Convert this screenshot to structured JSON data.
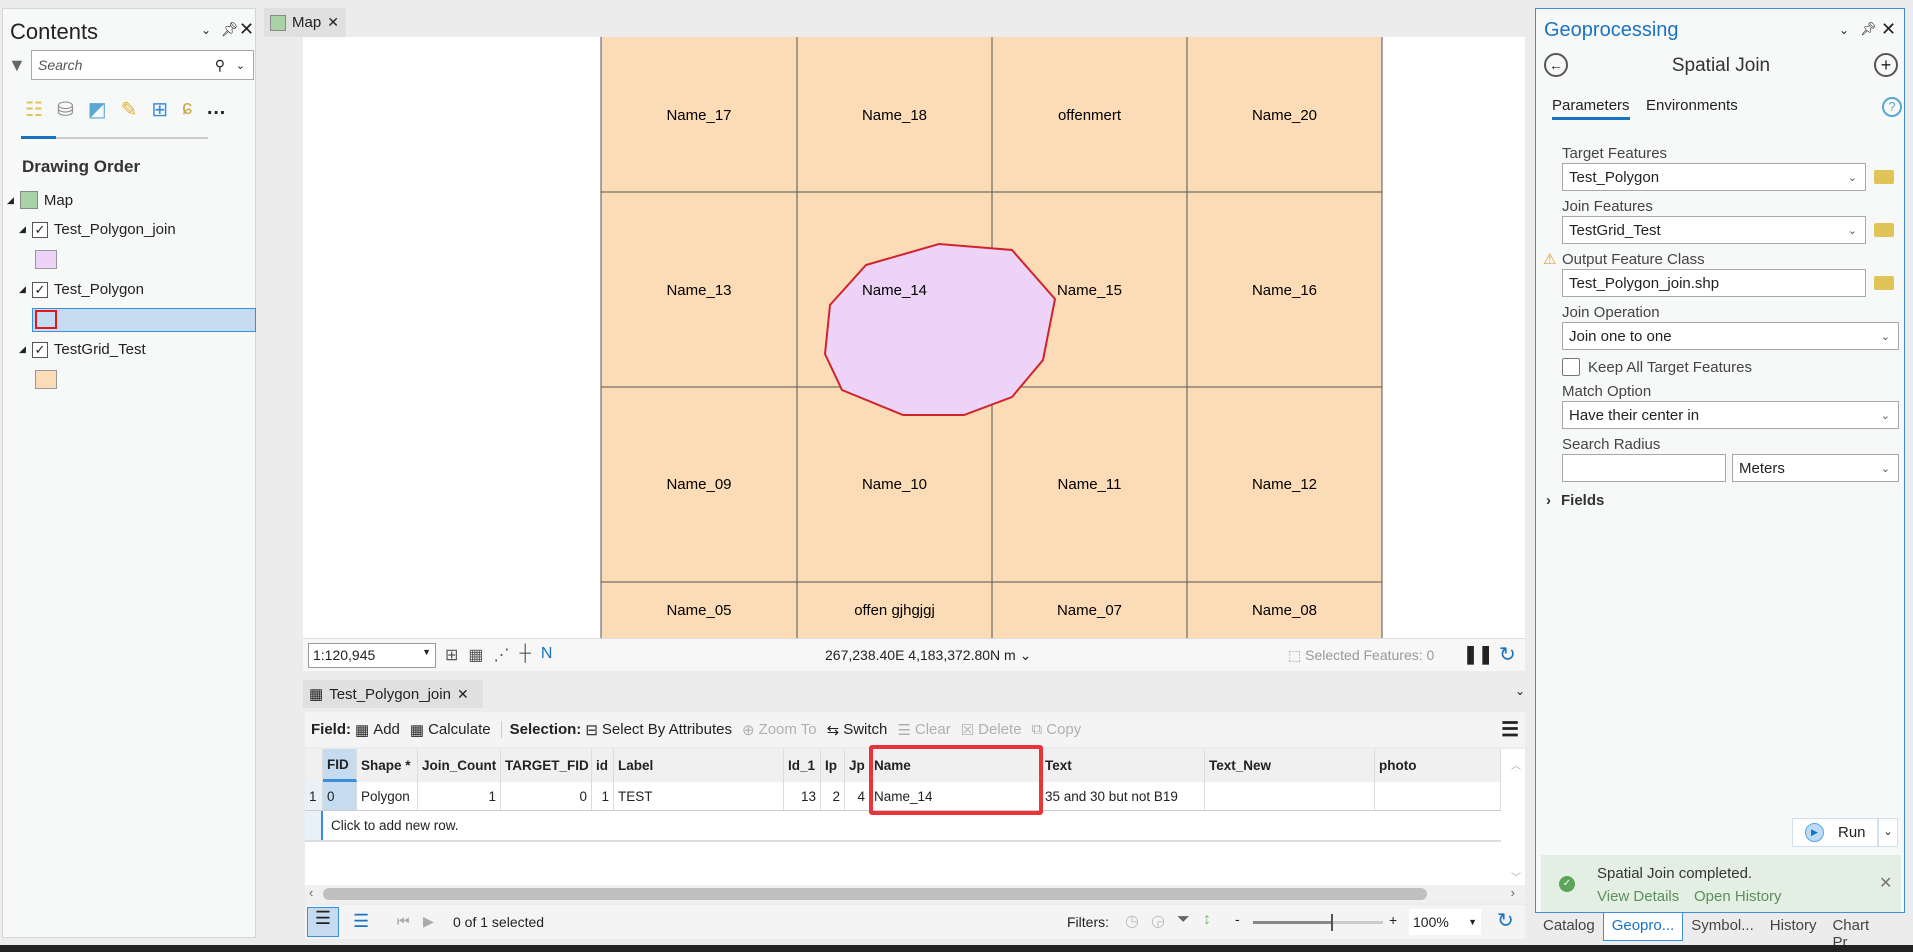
{
  "contents": {
    "title": "Contents",
    "search_placeholder": "Search",
    "section": "Drawing Order",
    "layers": [
      {
        "name": "Map"
      },
      {
        "name": "Test_Polygon_join",
        "swatch": "#ecd3f7"
      },
      {
        "name": "Test_Polygon",
        "swatch": "#c5dbef"
      },
      {
        "name": "TestGrid_Test",
        "swatch": "#fcdcb6"
      }
    ]
  },
  "map": {
    "tab": "Map",
    "scale": "1:120,945",
    "coords": "267,238.40E 4,183,372.80N m",
    "selected": "Selected Features: 0",
    "grid_fill": "#fcdcb6",
    "polygon_fill": "#ecd3f7",
    "polygon_stroke": "#d0242c",
    "cells": [
      [
        "Name_17",
        "Name_18",
        "offenmert",
        "Name_20"
      ],
      [
        "Name_13",
        "Name_14",
        "Name_15",
        "Name_16"
      ],
      [
        "Name_09",
        "Name_10",
        "Name_11",
        "Name_12"
      ],
      [
        "Name_05",
        "offen gjhgjgj",
        "Name_07",
        "Name_08"
      ]
    ]
  },
  "table": {
    "tab": "Test_Polygon_join",
    "toolbar": {
      "field": "Field:",
      "add": "Add",
      "calculate": "Calculate",
      "selection": "Selection:",
      "select_by_attr": "Select By Attributes",
      "zoom_to": "Zoom To",
      "switch": "Switch",
      "clear": "Clear",
      "delete": "Delete",
      "copy": "Copy"
    },
    "columns": [
      "FID",
      "Shape *",
      "Join_Count",
      "TARGET_FID",
      "id",
      "Label",
      "Id_1",
      "Ip",
      "Jp",
      "Name",
      "Text",
      "Text_New",
      "photo"
    ],
    "rows": [
      {
        "num": "1",
        "cells": [
          "0",
          "Polygon",
          "1",
          "0",
          "1",
          "TEST",
          "13",
          "2",
          "4",
          "Name_14",
          "35 and 30 but not B19",
          "",
          ""
        ]
      }
    ],
    "add_row": "Click to add new row.",
    "selected": "0 of 1 selected",
    "filters": "Filters:",
    "zoom": "100%",
    "highlight_color": "#e8343a"
  },
  "gp": {
    "title": "Geoprocessing",
    "tool": "Spatial Join",
    "tabs": [
      "Parameters",
      "Environments"
    ],
    "target_label": "Target Features",
    "target": "Test_Polygon",
    "join_label": "Join Features",
    "join": "TestGrid_Test",
    "output_label": "Output Feature Class",
    "output": "Test_Polygon_join.shp",
    "op_label": "Join Operation",
    "op": "Join one to one",
    "keep_label": "Keep All Target Features",
    "keep_checked": false,
    "match_label": "Match Option",
    "match": "Have their center in",
    "radius_label": "Search Radius",
    "radius": "",
    "radius_unit": "Meters",
    "fields": "Fields",
    "run": "Run",
    "msg": "Spatial Join completed.",
    "view_details": "View Details",
    "open_history": "Open History",
    "bottom_tabs": [
      "Catalog",
      "Geopro...",
      "Symbol...",
      "History",
      "Chart Pr..."
    ]
  }
}
